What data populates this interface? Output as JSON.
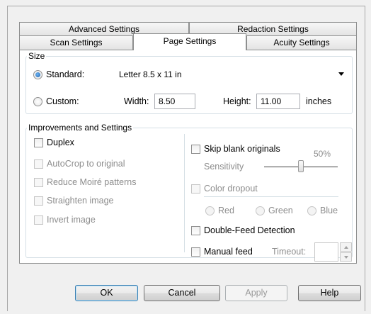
{
  "tabs": {
    "row1": [
      "Advanced Settings",
      "Redaction Settings"
    ],
    "row2": [
      "Scan Settings",
      "Page Settings",
      "Acuity Settings"
    ],
    "active": "Page Settings"
  },
  "size": {
    "group_title": "Size",
    "standard_label": "Standard:",
    "standard_value": "Letter 8.5 x 11 in",
    "custom_label": "Custom:",
    "width_label": "Width:",
    "width_value": "8.50",
    "height_label": "Height:",
    "height_value": "11.00",
    "units": "inches"
  },
  "improvements": {
    "group_title": "Improvements and Settings",
    "left": [
      "Duplex",
      "AutoCrop to original",
      "Reduce Moiré patterns",
      "Straighten image",
      "Invert image"
    ],
    "skip_blank": "Skip blank originals",
    "sensitivity_label": "Sensitivity",
    "sensitivity_value": "50%",
    "sensitivity_level": 0.5,
    "color_dropout": "Color dropout",
    "colors": [
      "Red",
      "Green",
      "Blue"
    ],
    "double_feed": "Double-Feed Detection",
    "manual_feed": "Manual feed",
    "timeout_label": "Timeout:",
    "timeout_value": ""
  },
  "buttons": {
    "ok": "OK",
    "cancel": "Cancel",
    "apply": "Apply",
    "help": "Help"
  },
  "colors": {
    "dialog_bg": "#f0f0f0",
    "panel_bg": "#ffffff",
    "disabled_text": "#8d8d8d",
    "default_button_border": "#3c7fb1"
  }
}
